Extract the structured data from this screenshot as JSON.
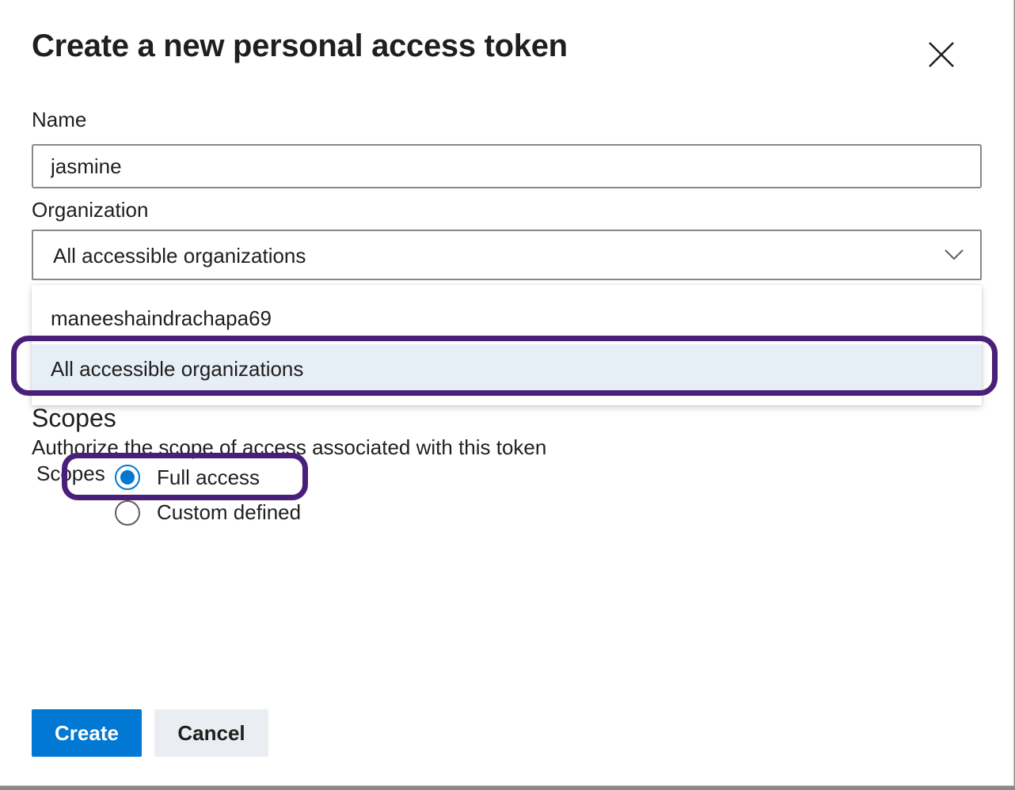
{
  "dialog": {
    "title": "Create a new personal access token"
  },
  "form": {
    "name_label": "Name",
    "name_value": "jasmine",
    "organization_label": "Organization",
    "organization_selected": "All accessible organizations",
    "organization_options": [
      "maneeshaindrachapa69",
      "All accessible organizations"
    ]
  },
  "scopes": {
    "title": "Scopes",
    "description": "Authorize the scope of access associated with this token",
    "group_label": "Scopes",
    "options": [
      {
        "label": "Full access",
        "checked": true
      },
      {
        "label": "Custom defined",
        "checked": false
      }
    ]
  },
  "footer": {
    "create_label": "Create",
    "cancel_label": "Cancel"
  },
  "colors": {
    "primary": "#0078d4",
    "annotation": "#4a1f7a",
    "selected_option_bg": "#e6eef6"
  },
  "icons": {
    "close": "close-icon",
    "dropdown": "chevron-down-icon"
  }
}
